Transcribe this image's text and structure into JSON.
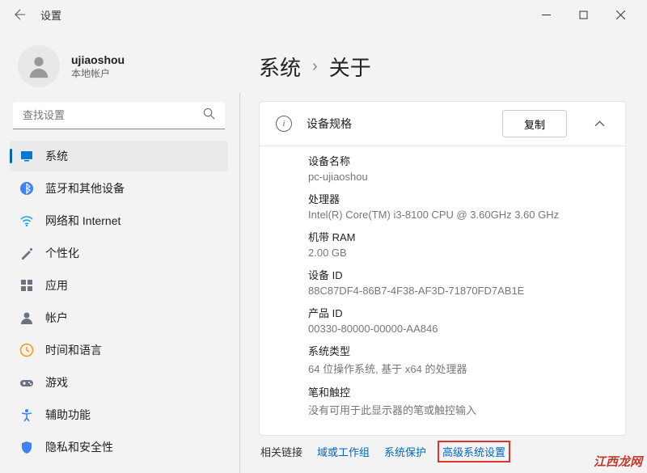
{
  "window": {
    "title": "设置"
  },
  "user": {
    "name": "ujiaoshou",
    "account_type": "本地帐户"
  },
  "search": {
    "placeholder": "查找设置"
  },
  "nav": {
    "items": [
      {
        "label": "系统",
        "icon": "display",
        "color": "#0078d4"
      },
      {
        "label": "蓝牙和其他设备",
        "icon": "bluetooth",
        "color": "#3b82f6"
      },
      {
        "label": "网络和 Internet",
        "icon": "wifi",
        "color": "#0ea5e9"
      },
      {
        "label": "个性化",
        "icon": "brush",
        "color": "#6b7280"
      },
      {
        "label": "应用",
        "icon": "apps",
        "color": "#6b7280"
      },
      {
        "label": "帐户",
        "icon": "person",
        "color": "#6b7280"
      },
      {
        "label": "时间和语言",
        "icon": "clock",
        "color": "#f59e0b"
      },
      {
        "label": "游戏",
        "icon": "game",
        "color": "#6b7280"
      },
      {
        "label": "辅助功能",
        "icon": "accessibility",
        "color": "#3b82f6"
      },
      {
        "label": "隐私和安全性",
        "icon": "shield",
        "color": "#3b82f6"
      }
    ]
  },
  "breadcrumb": {
    "parent": "系统",
    "current": "关于"
  },
  "device_specs": {
    "section_title": "设备规格",
    "copy_label": "复制",
    "rows": [
      {
        "label": "设备名称",
        "value": "pc-ujiaoshou"
      },
      {
        "label": "处理器",
        "value": "Intel(R) Core(TM) i3-8100 CPU @ 3.60GHz   3.60 GHz"
      },
      {
        "label": "机带 RAM",
        "value": "2.00 GB"
      },
      {
        "label": "设备 ID",
        "value": "88C87DF4-86B7-4F38-AF3D-71870FD7AB1E"
      },
      {
        "label": "产品 ID",
        "value": "00330-80000-00000-AA846"
      },
      {
        "label": "系统类型",
        "value": "64 位操作系统, 基于 x64 的处理器"
      },
      {
        "label": "笔和触控",
        "value": "没有可用于此显示器的笔或触控输入"
      }
    ]
  },
  "related_links": {
    "label": "相关链接",
    "items": [
      "域或工作组",
      "系统保护",
      "高级系统设置"
    ]
  },
  "watermark": "江西龙网"
}
